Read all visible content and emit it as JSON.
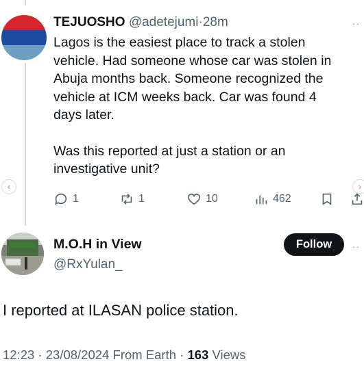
{
  "tweet1": {
    "display_name": "TEJUOSHO",
    "handle": "@adetejumi",
    "separator": "·",
    "time": "28m",
    "more": "··",
    "lines_p1": [
      "Lagos is the easiest place to track a stolen",
      "vehicle. Had someone whose car was stolen in",
      "Abuja months back. Someone recognized the",
      "vehicle at ICM weeks back. Car was found 4",
      "days later."
    ],
    "lines_p2": [
      "Was this reported at just a station or an",
      "investigative unit?"
    ],
    "avatar_colors": [
      "#d8262e",
      "#1e4b9c",
      "#6c9fc2"
    ]
  },
  "actions": {
    "reply": {
      "icon": "reply-icon",
      "count": "1"
    },
    "retweet": {
      "icon": "retweet-icon",
      "count": "1"
    },
    "like": {
      "icon": "heart-icon",
      "count": "10"
    },
    "views": {
      "icon": "analytics-icon",
      "count": "462"
    },
    "bookmark": {
      "icon": "bookmark-icon"
    },
    "share": {
      "icon": "share-icon"
    }
  },
  "nav": {
    "prev": "‹",
    "next": "›"
  },
  "tweet2": {
    "display_name": "M.O.H in View",
    "handle": "@RxYulan_",
    "follow_label": "Follow",
    "more": "··",
    "text": "I reported at ILASAN police station.",
    "time": "12:23",
    "separator": "·",
    "date": "23/08/2024",
    "source": "From Earth",
    "views_count": "163",
    "views_label": "Views"
  },
  "colors": {
    "text": "#0f1419",
    "muted": "#536471",
    "button": "#0f1419"
  }
}
